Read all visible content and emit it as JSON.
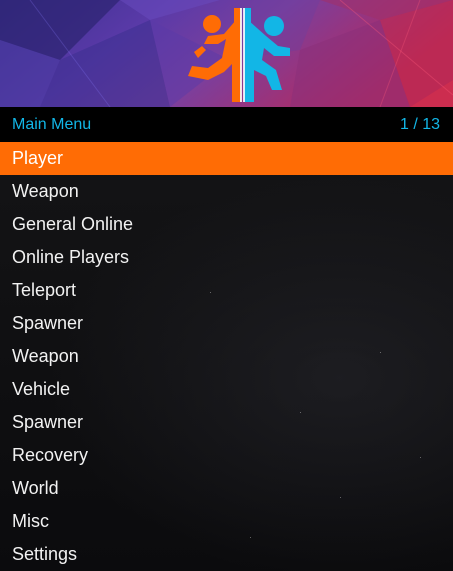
{
  "header": {
    "logo_icon": "portal-runner-logo-icon",
    "colors": {
      "orange": "#ff6c05",
      "blue": "#12b6e6"
    }
  },
  "subheader": {
    "title": "Main Menu",
    "counter": "1 / 13"
  },
  "menu": {
    "selected_index": 0,
    "items": [
      {
        "label": "Player"
      },
      {
        "label": "Weapon"
      },
      {
        "label": "General Online"
      },
      {
        "label": "Online Players"
      },
      {
        "label": "Teleport"
      },
      {
        "label": "Spawner"
      },
      {
        "label": "Weapon"
      },
      {
        "label": "Vehicle"
      },
      {
        "label": "Spawner"
      },
      {
        "label": "Recovery"
      },
      {
        "label": "World"
      },
      {
        "label": "Misc"
      },
      {
        "label": "Settings"
      }
    ]
  }
}
